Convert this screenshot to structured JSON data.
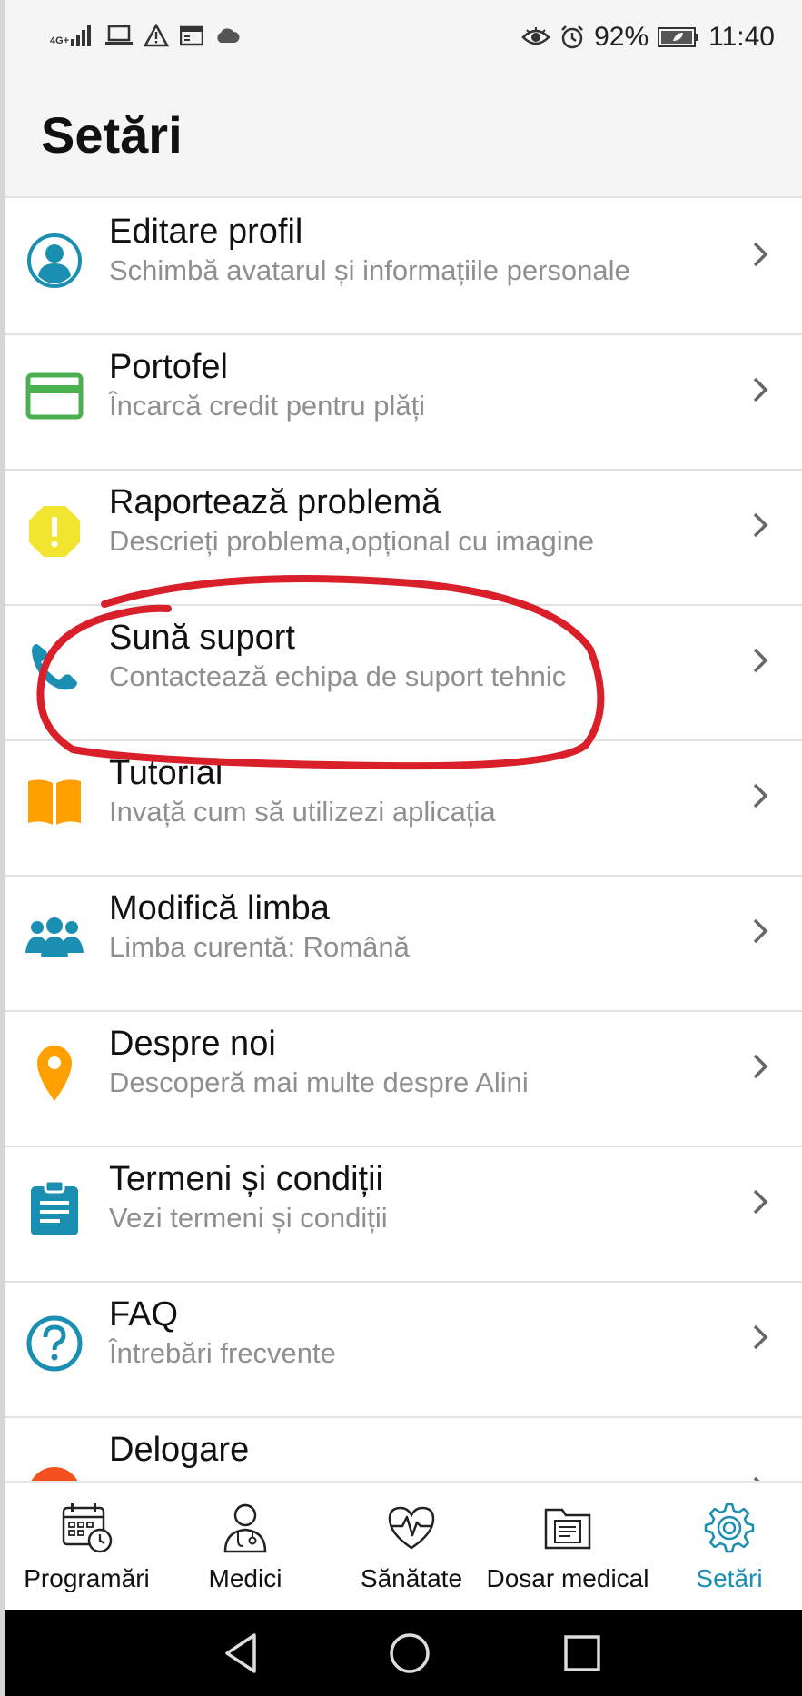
{
  "status_bar": {
    "network_type": "4G+",
    "battery": "92%",
    "time": "11:40"
  },
  "header": {
    "title": "Setări"
  },
  "settings": [
    {
      "title": "Editare profil",
      "subtitle": "Schimbă avatarul și informațiile personale",
      "icon": "profile-icon",
      "color": "#1a8fb2"
    },
    {
      "title": "Portofel",
      "subtitle": "Încarcă credit pentru plăți",
      "icon": "wallet-card-icon",
      "color": "#4caf50"
    },
    {
      "title": "Raportează problemă",
      "subtitle": "Descrieți problema,opțional cu imagine",
      "icon": "warning-icon",
      "color": "#f2e530"
    },
    {
      "title": "Sună suport",
      "subtitle": "Contactează echipa de suport tehnic",
      "icon": "phone-icon",
      "color": "#1a8fb2"
    },
    {
      "title": "Tutorial",
      "subtitle": "Invață cum să utilizezi aplicația",
      "icon": "book-icon",
      "color": "#ffa000"
    },
    {
      "title": "Modifică limba",
      "subtitle": "Limba curentă: Română",
      "icon": "people-icon",
      "color": "#1a8fb2"
    },
    {
      "title": "Despre noi",
      "subtitle": "Descoperă mai multe despre Alini",
      "icon": "location-pin-icon",
      "color": "#ffa000"
    },
    {
      "title": "Termeni și condiții",
      "subtitle": "Vezi termeni și condiții",
      "icon": "clipboard-icon",
      "color": "#1a8fb2"
    },
    {
      "title": "FAQ",
      "subtitle": "Întrebări frecvente",
      "icon": "help-circle-icon",
      "color": "#1a8fb2"
    },
    {
      "title": "Delogare",
      "subtitle": "",
      "icon": "logout-icon",
      "color": "#f4511e"
    }
  ],
  "bottom_nav": [
    {
      "label": "Programări",
      "icon": "calendar-clock-icon"
    },
    {
      "label": "Medici",
      "icon": "doctor-icon"
    },
    {
      "label": "Sănătate",
      "icon": "heart-pulse-icon"
    },
    {
      "label": "Dosar medical",
      "icon": "folder-document-icon"
    },
    {
      "label": "Setări",
      "icon": "settings-gear-icon",
      "active": true
    }
  ],
  "colors": {
    "accent": "#1a8fb2",
    "annotation": "#d9202a"
  }
}
